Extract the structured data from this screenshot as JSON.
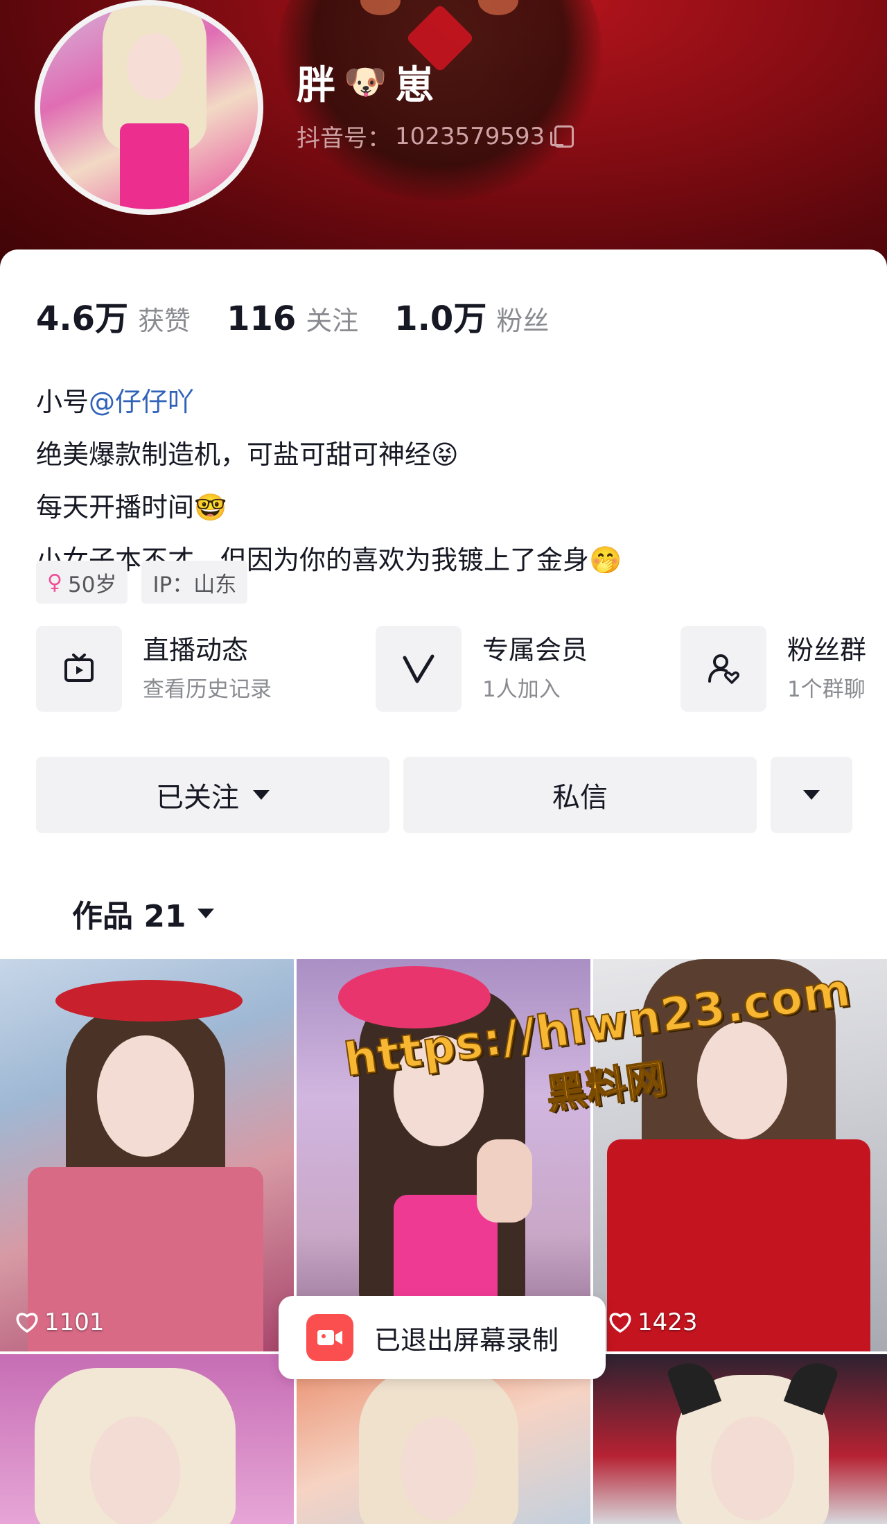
{
  "profile": {
    "nickname_left": "胖",
    "nickname_emoji": "🐶",
    "nickname_right": "崽",
    "douyin_id_label": "抖音号：",
    "douyin_id": "1023579593"
  },
  "stats": [
    {
      "value": "4.6万",
      "label": "获赞"
    },
    {
      "value": "116",
      "label": "关注"
    },
    {
      "value": "1.0万",
      "label": "粉丝"
    }
  ],
  "bio": {
    "prefix": "小号",
    "mention": "@仔仔吖",
    "line2": "绝美爆款制造机，可盐可甜可神经😝",
    "line3": "每天开播时间🤓",
    "line4": "小女子本不才，但因为你的喜欢为我镀上了金身🤭"
  },
  "tags": {
    "age": "50岁",
    "ip": "IP：山东"
  },
  "features": [
    {
      "title": "直播动态",
      "subtitle": "查看历史记录",
      "icon": "tv-icon"
    },
    {
      "title": "专属会员",
      "subtitle": "1人加入",
      "icon": "v-icon"
    },
    {
      "title": "粉丝群",
      "subtitle": "1个群聊",
      "icon": "group-icon"
    }
  ],
  "actions": {
    "follow": "已关注",
    "message": "私信"
  },
  "works": {
    "tab_label": "作品 21"
  },
  "grid": {
    "likes": [
      "1101",
      "1423"
    ]
  },
  "toast": {
    "text": "已退出屏幕录制"
  },
  "watermark": {
    "url": "https://hlwn23.com",
    "name": "黑料网"
  },
  "colors": {
    "header_red": "#8a0d14",
    "mention_blue": "#2f62b8",
    "toast_red": "#fb4e4e",
    "watermark_orange": "#f7b733"
  }
}
